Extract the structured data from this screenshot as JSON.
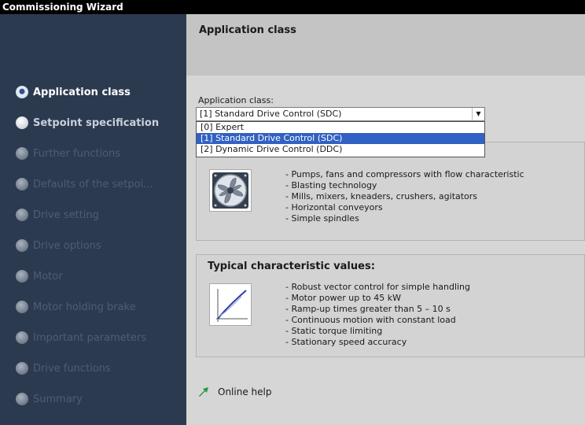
{
  "window": {
    "title": "Commissioning Wizard"
  },
  "steps": [
    {
      "label": "Application class",
      "state": "current"
    },
    {
      "label": "Setpoint specification",
      "state": "next"
    },
    {
      "label": "Further functions",
      "state": "disabled"
    },
    {
      "label": "Defaults of the setpoi...",
      "state": "disabled"
    },
    {
      "label": "Drive setting",
      "state": "disabled"
    },
    {
      "label": "Drive options",
      "state": "disabled"
    },
    {
      "label": "Motor",
      "state": "disabled"
    },
    {
      "label": "Motor holding brake",
      "state": "disabled"
    },
    {
      "label": "Important parameters",
      "state": "disabled"
    },
    {
      "label": "Drive functions",
      "state": "disabled"
    },
    {
      "label": "Summary",
      "state": "disabled"
    }
  ],
  "header": {
    "title": "Application class"
  },
  "field": {
    "label": "Application class:",
    "value": "[1] Standard Drive Control (SDC)",
    "options": [
      "[0] Expert",
      "[1] Standard Drive Control (SDC)",
      "[2] Dynamic Drive Control (DDC)"
    ]
  },
  "applications": {
    "items": [
      "- Pumps, fans and compressors with flow characteristic",
      "- Blasting technology",
      "- Mills, mixers, kneaders, crushers, agitators",
      "- Horizontal conveyors",
      "- Simple spindles"
    ]
  },
  "characteristics": {
    "title": "Typical characteristic values:",
    "items": [
      "- Robust vector control for simple handling",
      "- Motor power up to 45 kW",
      "- Ramp-up times greater than 5 – 10 s",
      "- Continuous motion with constant load",
      "- Static torque limiting",
      "- Stationary speed accuracy"
    ]
  },
  "help": {
    "label": "Online help"
  },
  "colors": {
    "sidebar": "#2c3a50",
    "selection": "#3161c2",
    "help_arrow": "#2e9a3a"
  }
}
